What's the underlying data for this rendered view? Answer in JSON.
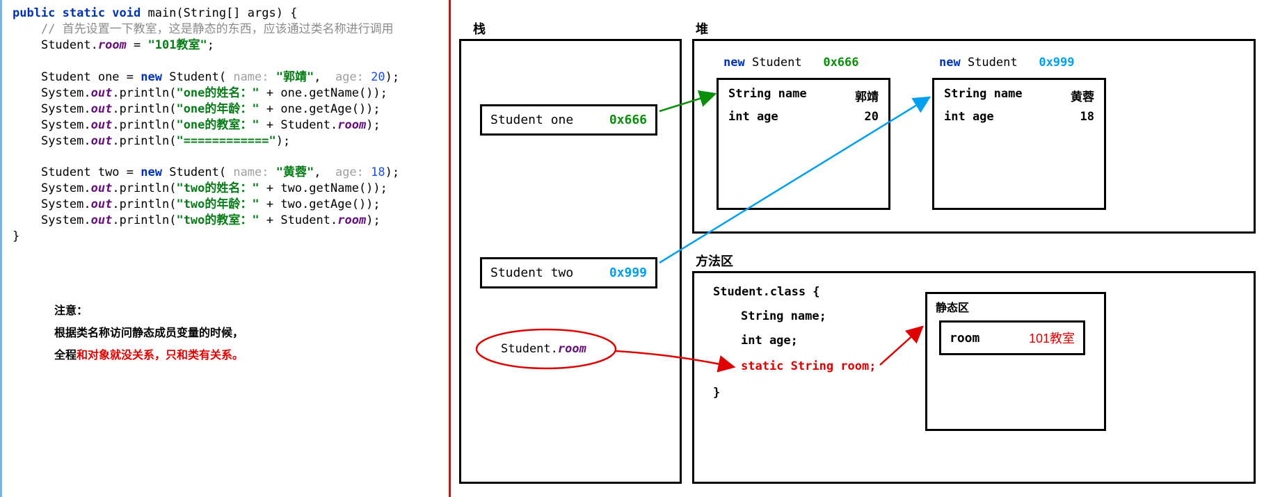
{
  "code": {
    "sig_pre": "public static void",
    "sig_main": " main",
    "sig_args": "(String[] args) {",
    "indent": "    ",
    "comment": "// 首先设置一下教室，这是静态的东西，应该通过类名称进行调用",
    "l_room": "Student.",
    "room_fld": "room",
    "l_room2": " = ",
    "l_room_str": "\"101教室\"",
    "semi": ";",
    "l_one_a": "Student one = ",
    "kw_new": "new",
    "l_one_b": " Student( ",
    "hint_name": "name: ",
    "val_name1": "\"郭靖\"",
    "comma": ", ",
    "hint_age": " age: ",
    "val_age1": "20",
    "paren_semi": ");",
    "l_print": "System.",
    "out": "out",
    "println": ".println(",
    "str_on1": "\"one的姓名：\"",
    "plus": " + ",
    "get1": "one.getName());",
    "str_on2": "\"one的年龄：\"",
    "get2": "one.getAge());",
    "str_on3": "\"one的教室：\"",
    "get3": "Student.",
    "room2": "room",
    "close": ");",
    "str_sep": "\"============\"",
    "close2": ");",
    "l_two_a": "Student two = ",
    "l_two_b": " Student( ",
    "val_name2": "\"黄蓉\"",
    "val_age2": "18",
    "str_tw1": "\"two的姓名：\"",
    "get_t1": "two.getName());",
    "str_tw2": "\"two的年龄：\"",
    "get_t2": "two.getAge());",
    "str_tw3": "\"two的教室：\"",
    "brace_close": "}"
  },
  "note": {
    "title": "注意：",
    "line1": "根据类名称访问静态成员变量的时候，",
    "line2a": "全程",
    "line2b": "和对象就没关系，只和类有关系。"
  },
  "diagram": {
    "stack_label": "栈",
    "heap_label": "堆",
    "method_label": "方法区",
    "static_label": "静态区",
    "stack": {
      "one_lbl": "Student one",
      "one_addr": "0x666",
      "two_lbl": "Student two",
      "two_addr": "0x999",
      "room_lbl_a": "Student.",
      "room_lbl_b": "room"
    },
    "heap": {
      "new_kw": "new",
      "student_txt": " Student",
      "addr1": "0x666",
      "addr2": "0x999",
      "name_lbl": "String name",
      "age_lbl": "int age",
      "name1": "郭靖",
      "age1": "20",
      "name2": "黄蓉",
      "age2": "18"
    },
    "method": {
      "class_open": "Student.class {",
      "f_name": "String name;",
      "f_age": "int age;",
      "f_room": "static String room;",
      "class_close": "}",
      "room_key": "room",
      "room_val": "101教室"
    }
  }
}
